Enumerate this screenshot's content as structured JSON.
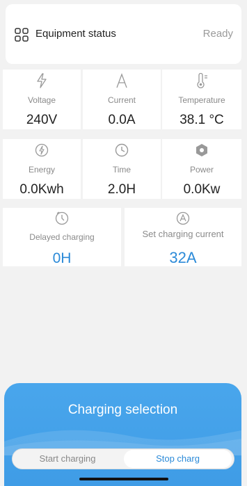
{
  "equipment_status": {
    "label": "Equipment status",
    "value": "Ready",
    "icon": "grid-icon"
  },
  "metrics_row1": [
    {
      "label": "Voltage",
      "value": "240V",
      "icon": "bolt-icon"
    },
    {
      "label": "Current",
      "value": "0.0A",
      "icon": "current-a-icon"
    },
    {
      "label": "Temperature",
      "value": "38.1 °C",
      "icon": "thermometer-icon"
    }
  ],
  "metrics_row2": [
    {
      "label": "Energy",
      "value": "0.0Kwh",
      "icon": "energy-icon"
    },
    {
      "label": "Time",
      "value": "2.0H",
      "icon": "clock-icon"
    },
    {
      "label": "Power",
      "value": "0.0Kw",
      "icon": "power-hex-icon"
    }
  ],
  "delayed_charging": {
    "label": "Delayed charging",
    "value": "0H",
    "icon": "timer-icon"
  },
  "set_charging_current": {
    "label": "Set charging current",
    "value": "32A",
    "icon": "current-setting-icon"
  },
  "charging_selection": {
    "title": "Charging selection",
    "start_label": "Start charging",
    "stop_label": "Stop charg",
    "selected": "stop"
  },
  "colors": {
    "accent": "#2b8ad8",
    "panel": "#44a2ea",
    "background": "#f2f2f2"
  }
}
